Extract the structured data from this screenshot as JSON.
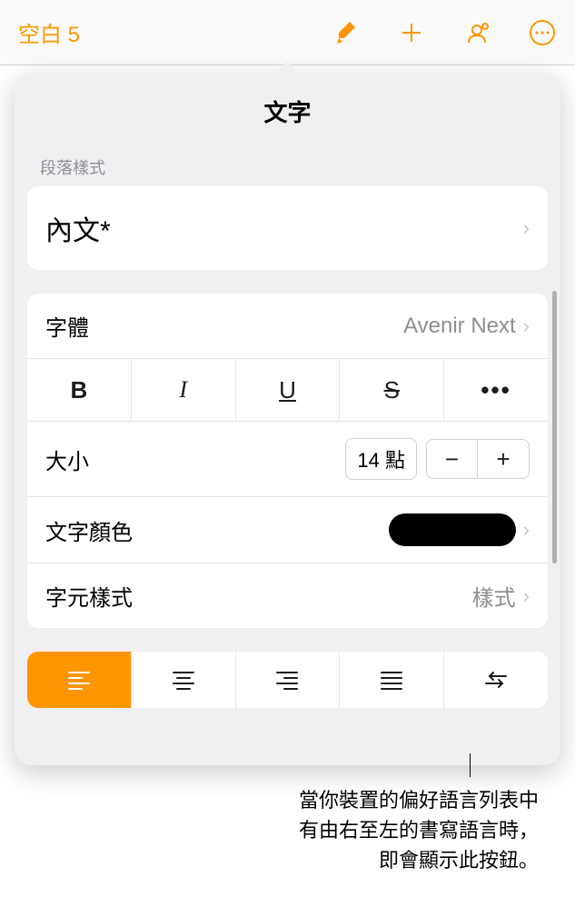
{
  "toolbar": {
    "title": "空白 5"
  },
  "panel": {
    "title": "文字",
    "paragraphStyleLabel": "段落樣式",
    "paragraphStyleValue": "內文*",
    "fontLabel": "字體",
    "fontValue": "Avenir Next",
    "boldLabel": "B",
    "italicLabel": "I",
    "underlineLabel": "U",
    "strikeLabel": "S",
    "moreLabel": "•••",
    "sizeLabel": "大小",
    "sizeValue": "14 點",
    "textColorLabel": "文字顏色",
    "textColorValue": "#000000",
    "charStyleLabel": "字元樣式",
    "charStyleValue": "樣式"
  },
  "callout": {
    "line1": "當你裝置的偏好語言列表中",
    "line2": "有由右至左的書寫語言時，",
    "line3": "即會顯示此按鈕。"
  }
}
